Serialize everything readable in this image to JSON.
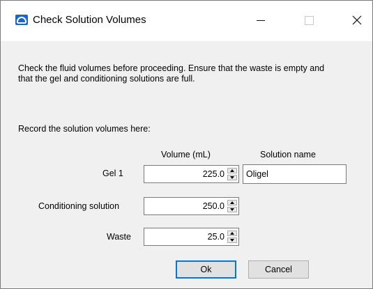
{
  "window": {
    "title": "Check Solution Volumes",
    "icon": "app-logo-icon"
  },
  "dialog": {
    "instructions": "Check the fluid volumes before proceeding. Ensure that the waste is empty and that the gel and conditioning solutions are full.",
    "record_label": "Record the solution volumes here:",
    "columns": {
      "volume": "Volume (mL)",
      "solution_name": "Solution name"
    },
    "rows": [
      {
        "label": "Gel 1",
        "volume": "225.0",
        "solution_name": "Oligel"
      },
      {
        "label": "Conditioning solution",
        "volume": "250.0"
      },
      {
        "label": "Waste",
        "volume": "25.0"
      }
    ],
    "buttons": {
      "ok": "Ok",
      "cancel": "Cancel"
    }
  },
  "colors": {
    "titlebar": "#ffffff",
    "body": "#f0f0f0",
    "focus_accent": "#0078d7",
    "app_icon": "#1a66c9"
  }
}
